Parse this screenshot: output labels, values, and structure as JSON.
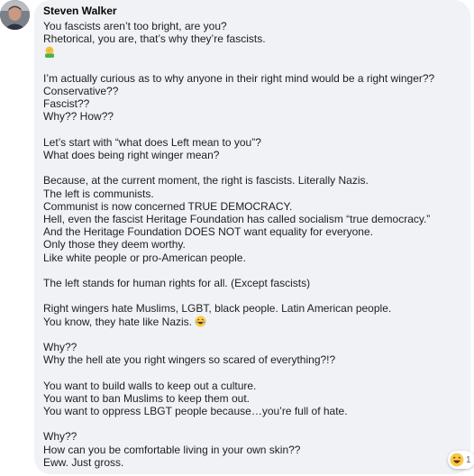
{
  "comment": {
    "author": "Steven Walker",
    "paragraphs": [
      [
        "You fascists aren’t too bright, are you?",
        "Rhetorical, you are, that’s why they’re fascists."
      ],
      [
        "I’m actually curious as to why anyone in their right mind would be a right winger??",
        "Conservative??",
        "Fascist??",
        "Why?? How??"
      ],
      [
        "Let’s start with “what does Left mean to you”?",
        "What does being right winger mean?"
      ],
      [
        "Because, at the current moment, the right is fascists. Literally Nazis.",
        "The left is communists.",
        "Communist is now concerned TRUE DEMOCRACY.",
        "Hell, even the fascist Heritage Foundation has called socialism “true democracy.”",
        "And the Heritage Foundation DOES NOT want equality for everyone.",
        "Only those they deem worthy.",
        "Like white people or pro-American people."
      ],
      [
        "The left stands for human rights for all. (Except fascists)"
      ],
      [
        "Right wingers hate Muslims, LGBT, black people. Latin American people.",
        "You know, they hate like Nazis."
      ],
      [
        "Why??",
        "Why the hell ate you right wingers so scared of everything?!?"
      ],
      [
        "You want to build walls to keep out a culture.",
        "You want to ban Muslims to keep them out.",
        "You want to oppress LBGT people because…you’re full of hate."
      ],
      [
        "Why??",
        "How can you be comfortable living in your own skin??",
        "Eww. Just gross."
      ]
    ]
  },
  "reactions": {
    "count": "1",
    "icon": "haha-emoji"
  },
  "icons": {
    "facepalm": "man-facepalming-emoji",
    "laugh": "laughing-emoji"
  },
  "colors": {
    "bubble": "#f0f2f5",
    "text": "#1c1e21",
    "name": "#050505",
    "muted": "#65676b"
  }
}
